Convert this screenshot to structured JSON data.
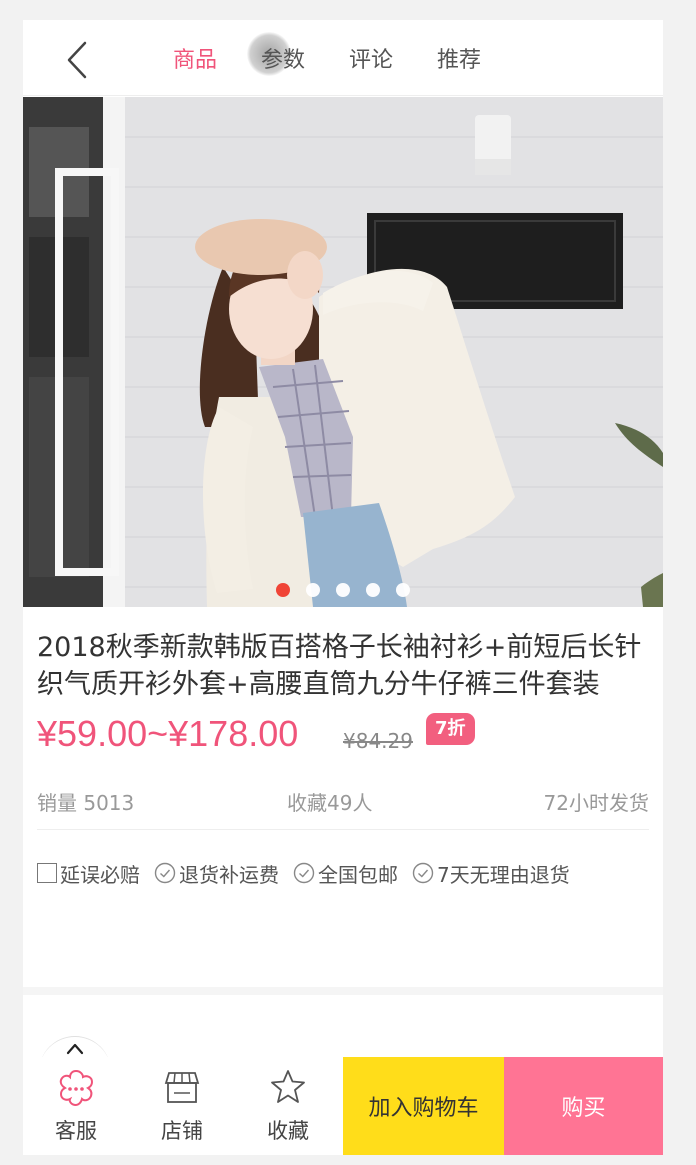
{
  "header": {
    "tabs": [
      {
        "label": "商品",
        "active": true
      },
      {
        "label": "参数",
        "active": false
      },
      {
        "label": "评论",
        "active": false
      },
      {
        "label": "推荐",
        "active": false
      }
    ]
  },
  "banner": {
    "slide_count": 5,
    "active_index": 0
  },
  "product": {
    "title": "2018秋季新款韩版百搭格子长袖衬衫+前短后长针织气质开衫外套+高腰直筒九分牛仔裤三件套装",
    "price": "¥59.00~¥178.00",
    "old_price": "¥84.29",
    "discount": "7折",
    "sales": "销量 5013",
    "favorites": "收藏49人",
    "shipping": "72小时发货"
  },
  "guarantees": [
    {
      "label": "延误必赔",
      "icon": "square-icon"
    },
    {
      "label": "退货补运费",
      "icon": "check-circle-icon"
    },
    {
      "label": "全国包邮",
      "icon": "check-circle-icon"
    },
    {
      "label": "7天无理由退货",
      "icon": "check-circle-icon"
    }
  ],
  "bottom_bar": {
    "service_label": "客服",
    "shop_label": "店铺",
    "favorite_label": "收藏",
    "cart_label": "加入购物车",
    "buy_label": "购买"
  },
  "colors": {
    "accent": "#f0547a",
    "cart_button": "#ffdd1a",
    "buy_button": "#ff7494"
  }
}
